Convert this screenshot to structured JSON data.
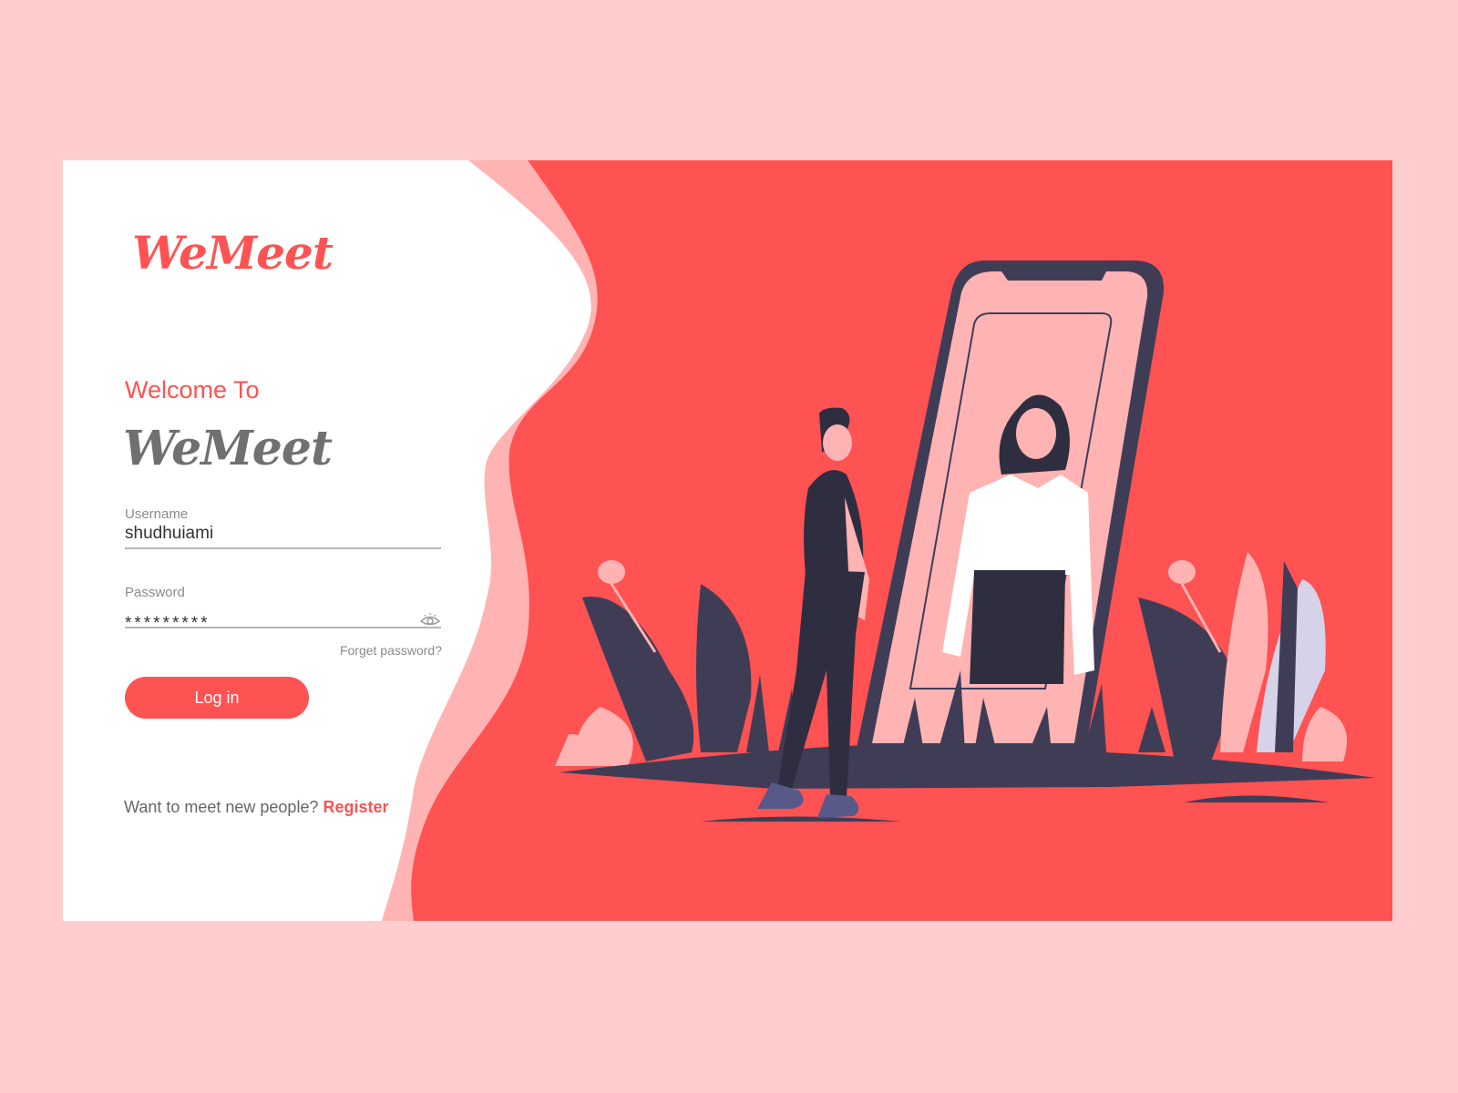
{
  "brand": {
    "logo": "WeMeet"
  },
  "login": {
    "welcome": "Welcome To",
    "brand_name": "WeMeet",
    "username_label": "Username",
    "username_value": "shudhuiami",
    "password_label": "Password",
    "password_mask": "*********",
    "forget_password": "Forget password?",
    "login_button": "Log in",
    "register_prompt": "Want to meet new people?",
    "register_link": "Register"
  },
  "colors": {
    "accent": "#ff5252",
    "page_bg": "#ffcdcd",
    "pink": "#ffb3b3",
    "dark": "#3f3d56"
  },
  "icons": {
    "password_toggle": "eye-icon"
  }
}
